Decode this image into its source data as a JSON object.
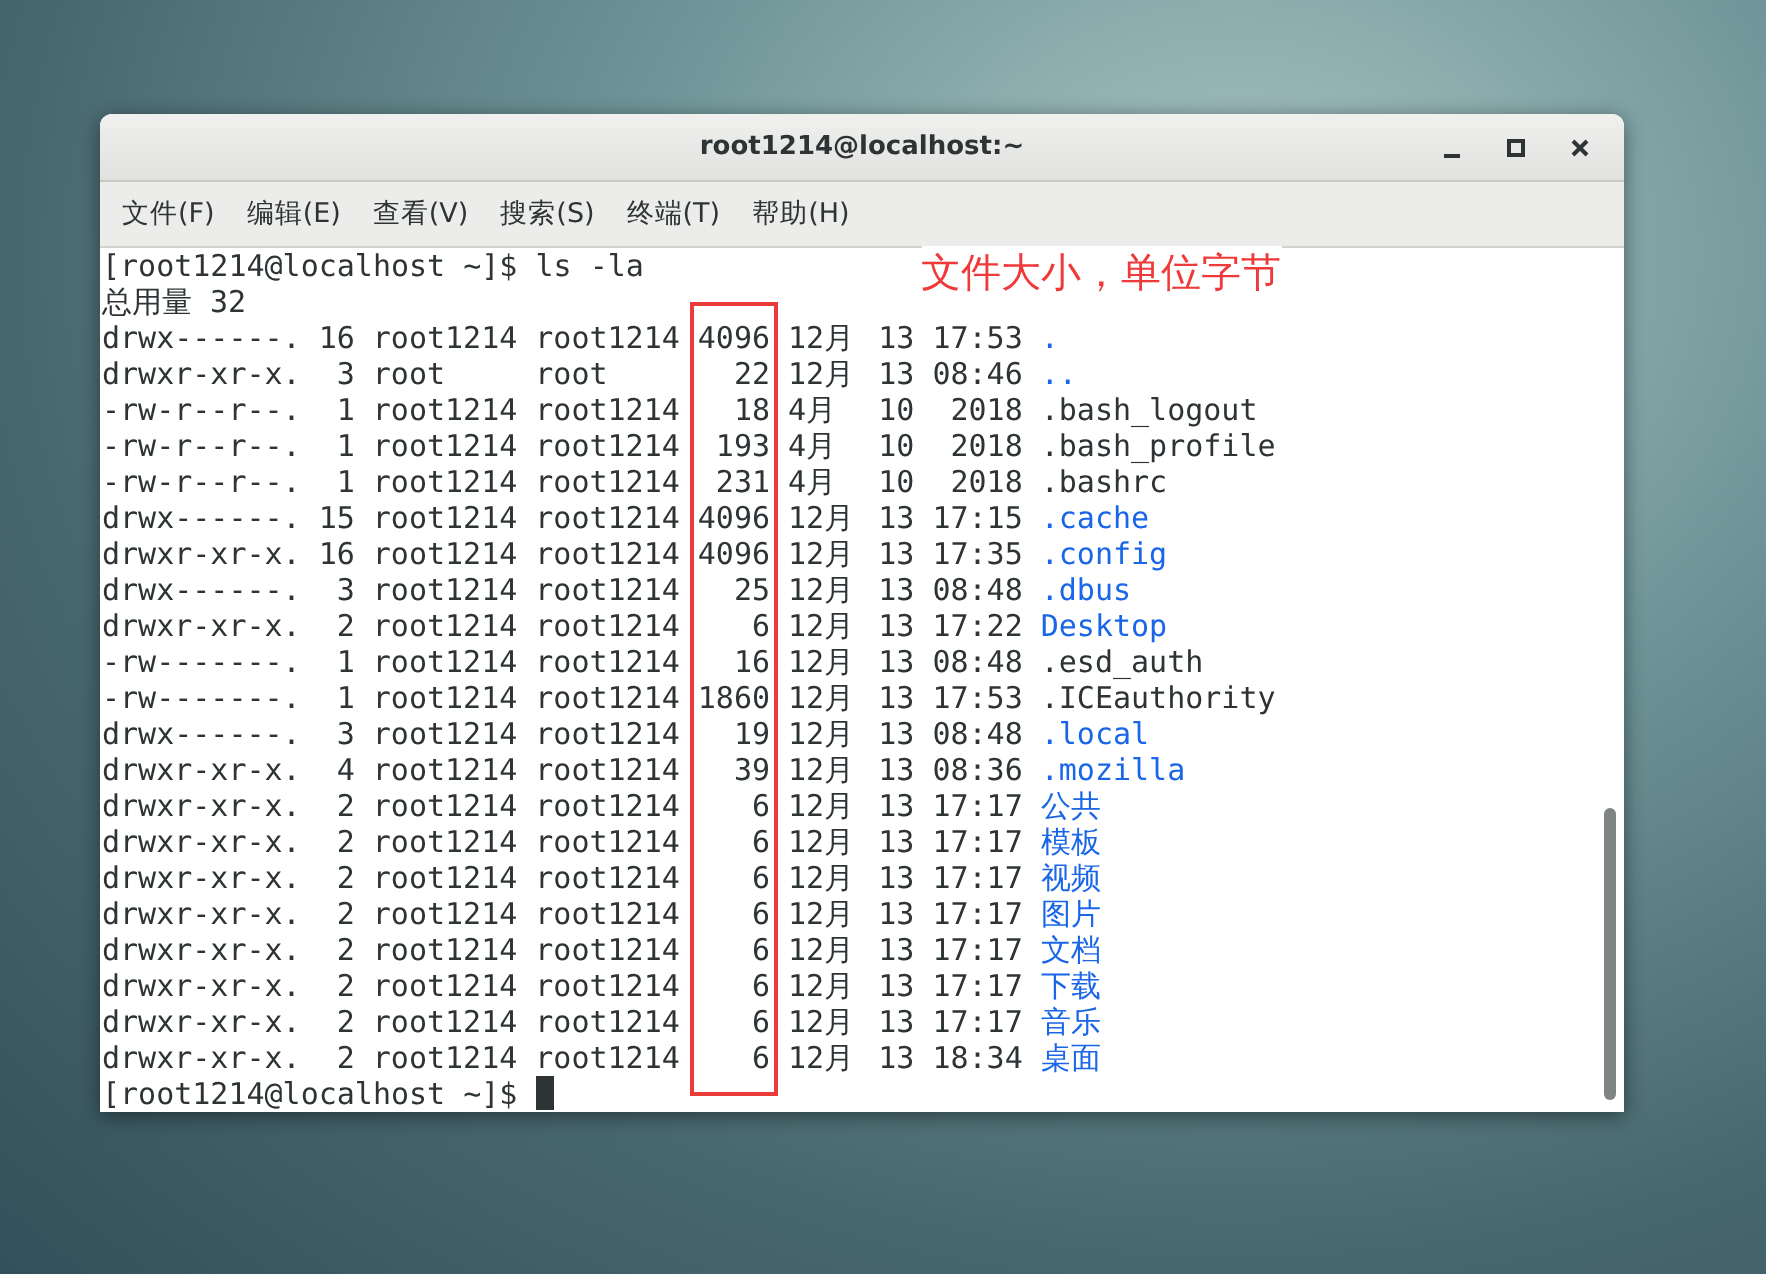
{
  "window": {
    "title": "root1214@localhost:~"
  },
  "menu": [
    "文件(F)",
    "编辑(E)",
    "查看(V)",
    "搜索(S)",
    "终端(T)",
    "帮助(H)"
  ],
  "terminal": {
    "prompt": "[root1214@localhost ~]$",
    "command": "ls -la",
    "total": "总用量 32",
    "rows": [
      {
        "perms": "drwx------.",
        "links": "16",
        "owner": "root1214",
        "group": "root1214",
        "size": "4096",
        "month": "12月",
        "day": "13",
        "time": "17:53",
        "name": ".",
        "kind": "dir"
      },
      {
        "perms": "drwxr-xr-x.",
        "links": "3",
        "owner": "root",
        "group": "root",
        "size": "22",
        "month": "12月",
        "day": "13",
        "time": "08:46",
        "name": "..",
        "kind": "dir"
      },
      {
        "perms": "-rw-r--r--.",
        "links": "1",
        "owner": "root1214",
        "group": "root1214",
        "size": "18",
        "month": "4月",
        "day": "10",
        "time": "2018",
        "name": ".bash_logout",
        "kind": "file"
      },
      {
        "perms": "-rw-r--r--.",
        "links": "1",
        "owner": "root1214",
        "group": "root1214",
        "size": "193",
        "month": "4月",
        "day": "10",
        "time": "2018",
        "name": ".bash_profile",
        "kind": "file"
      },
      {
        "perms": "-rw-r--r--.",
        "links": "1",
        "owner": "root1214",
        "group": "root1214",
        "size": "231",
        "month": "4月",
        "day": "10",
        "time": "2018",
        "name": ".bashrc",
        "kind": "file"
      },
      {
        "perms": "drwx------.",
        "links": "15",
        "owner": "root1214",
        "group": "root1214",
        "size": "4096",
        "month": "12月",
        "day": "13",
        "time": "17:15",
        "name": ".cache",
        "kind": "dir"
      },
      {
        "perms": "drwxr-xr-x.",
        "links": "16",
        "owner": "root1214",
        "group": "root1214",
        "size": "4096",
        "month": "12月",
        "day": "13",
        "time": "17:35",
        "name": ".config",
        "kind": "dir"
      },
      {
        "perms": "drwx------.",
        "links": "3",
        "owner": "root1214",
        "group": "root1214",
        "size": "25",
        "month": "12月",
        "day": "13",
        "time": "08:48",
        "name": ".dbus",
        "kind": "dir"
      },
      {
        "perms": "drwxr-xr-x.",
        "links": "2",
        "owner": "root1214",
        "group": "root1214",
        "size": "6",
        "month": "12月",
        "day": "13",
        "time": "17:22",
        "name": "Desktop",
        "kind": "dir"
      },
      {
        "perms": "-rw-------.",
        "links": "1",
        "owner": "root1214",
        "group": "root1214",
        "size": "16",
        "month": "12月",
        "day": "13",
        "time": "08:48",
        "name": ".esd_auth",
        "kind": "file"
      },
      {
        "perms": "-rw-------.",
        "links": "1",
        "owner": "root1214",
        "group": "root1214",
        "size": "1860",
        "month": "12月",
        "day": "13",
        "time": "17:53",
        "name": ".ICEauthority",
        "kind": "file"
      },
      {
        "perms": "drwx------.",
        "links": "3",
        "owner": "root1214",
        "group": "root1214",
        "size": "19",
        "month": "12月",
        "day": "13",
        "time": "08:48",
        "name": ".local",
        "kind": "dir"
      },
      {
        "perms": "drwxr-xr-x.",
        "links": "4",
        "owner": "root1214",
        "group": "root1214",
        "size": "39",
        "month": "12月",
        "day": "13",
        "time": "08:36",
        "name": ".mozilla",
        "kind": "dir"
      },
      {
        "perms": "drwxr-xr-x.",
        "links": "2",
        "owner": "root1214",
        "group": "root1214",
        "size": "6",
        "month": "12月",
        "day": "13",
        "time": "17:17",
        "name": "公共",
        "kind": "dir"
      },
      {
        "perms": "drwxr-xr-x.",
        "links": "2",
        "owner": "root1214",
        "group": "root1214",
        "size": "6",
        "month": "12月",
        "day": "13",
        "time": "17:17",
        "name": "模板",
        "kind": "dir"
      },
      {
        "perms": "drwxr-xr-x.",
        "links": "2",
        "owner": "root1214",
        "group": "root1214",
        "size": "6",
        "month": "12月",
        "day": "13",
        "time": "17:17",
        "name": "视频",
        "kind": "dir"
      },
      {
        "perms": "drwxr-xr-x.",
        "links": "2",
        "owner": "root1214",
        "group": "root1214",
        "size": "6",
        "month": "12月",
        "day": "13",
        "time": "17:17",
        "name": "图片",
        "kind": "dir"
      },
      {
        "perms": "drwxr-xr-x.",
        "links": "2",
        "owner": "root1214",
        "group": "root1214",
        "size": "6",
        "month": "12月",
        "day": "13",
        "time": "17:17",
        "name": "文档",
        "kind": "dir"
      },
      {
        "perms": "drwxr-xr-x.",
        "links": "2",
        "owner": "root1214",
        "group": "root1214",
        "size": "6",
        "month": "12月",
        "day": "13",
        "time": "17:17",
        "name": "下载",
        "kind": "dir"
      },
      {
        "perms": "drwxr-xr-x.",
        "links": "2",
        "owner": "root1214",
        "group": "root1214",
        "size": "6",
        "month": "12月",
        "day": "13",
        "time": "17:17",
        "name": "音乐",
        "kind": "dir"
      },
      {
        "perms": "drwxr-xr-x.",
        "links": "2",
        "owner": "root1214",
        "group": "root1214",
        "size": "6",
        "month": "12月",
        "day": "13",
        "time": "18:34",
        "name": "桌面",
        "kind": "dir"
      }
    ],
    "final_prompt": "[root1214@localhost ~]$"
  },
  "annotation": {
    "text": "文件大小，单位字节"
  }
}
